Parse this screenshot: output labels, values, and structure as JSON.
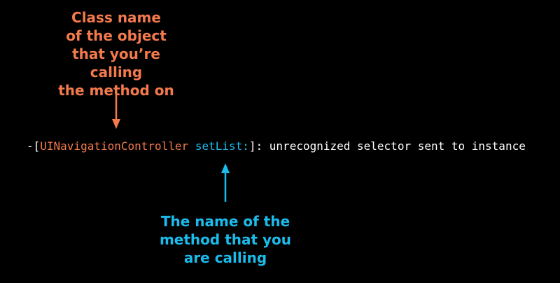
{
  "annotations": {
    "class_label": [
      "Class name",
      "of the object",
      "that you’re calling",
      "the method on"
    ],
    "method_label": [
      "The name of the",
      "method that you",
      "are calling"
    ]
  },
  "code": {
    "prefix": "-[",
    "class_name": "UINavigationController",
    "space": " ",
    "selector": "setList:",
    "suffix": "]: unrecognized selector sent to instance"
  },
  "colors": {
    "class": "#f47a4c",
    "selector": "#1bbcec",
    "text": "#ffffff",
    "background": "#000000"
  }
}
